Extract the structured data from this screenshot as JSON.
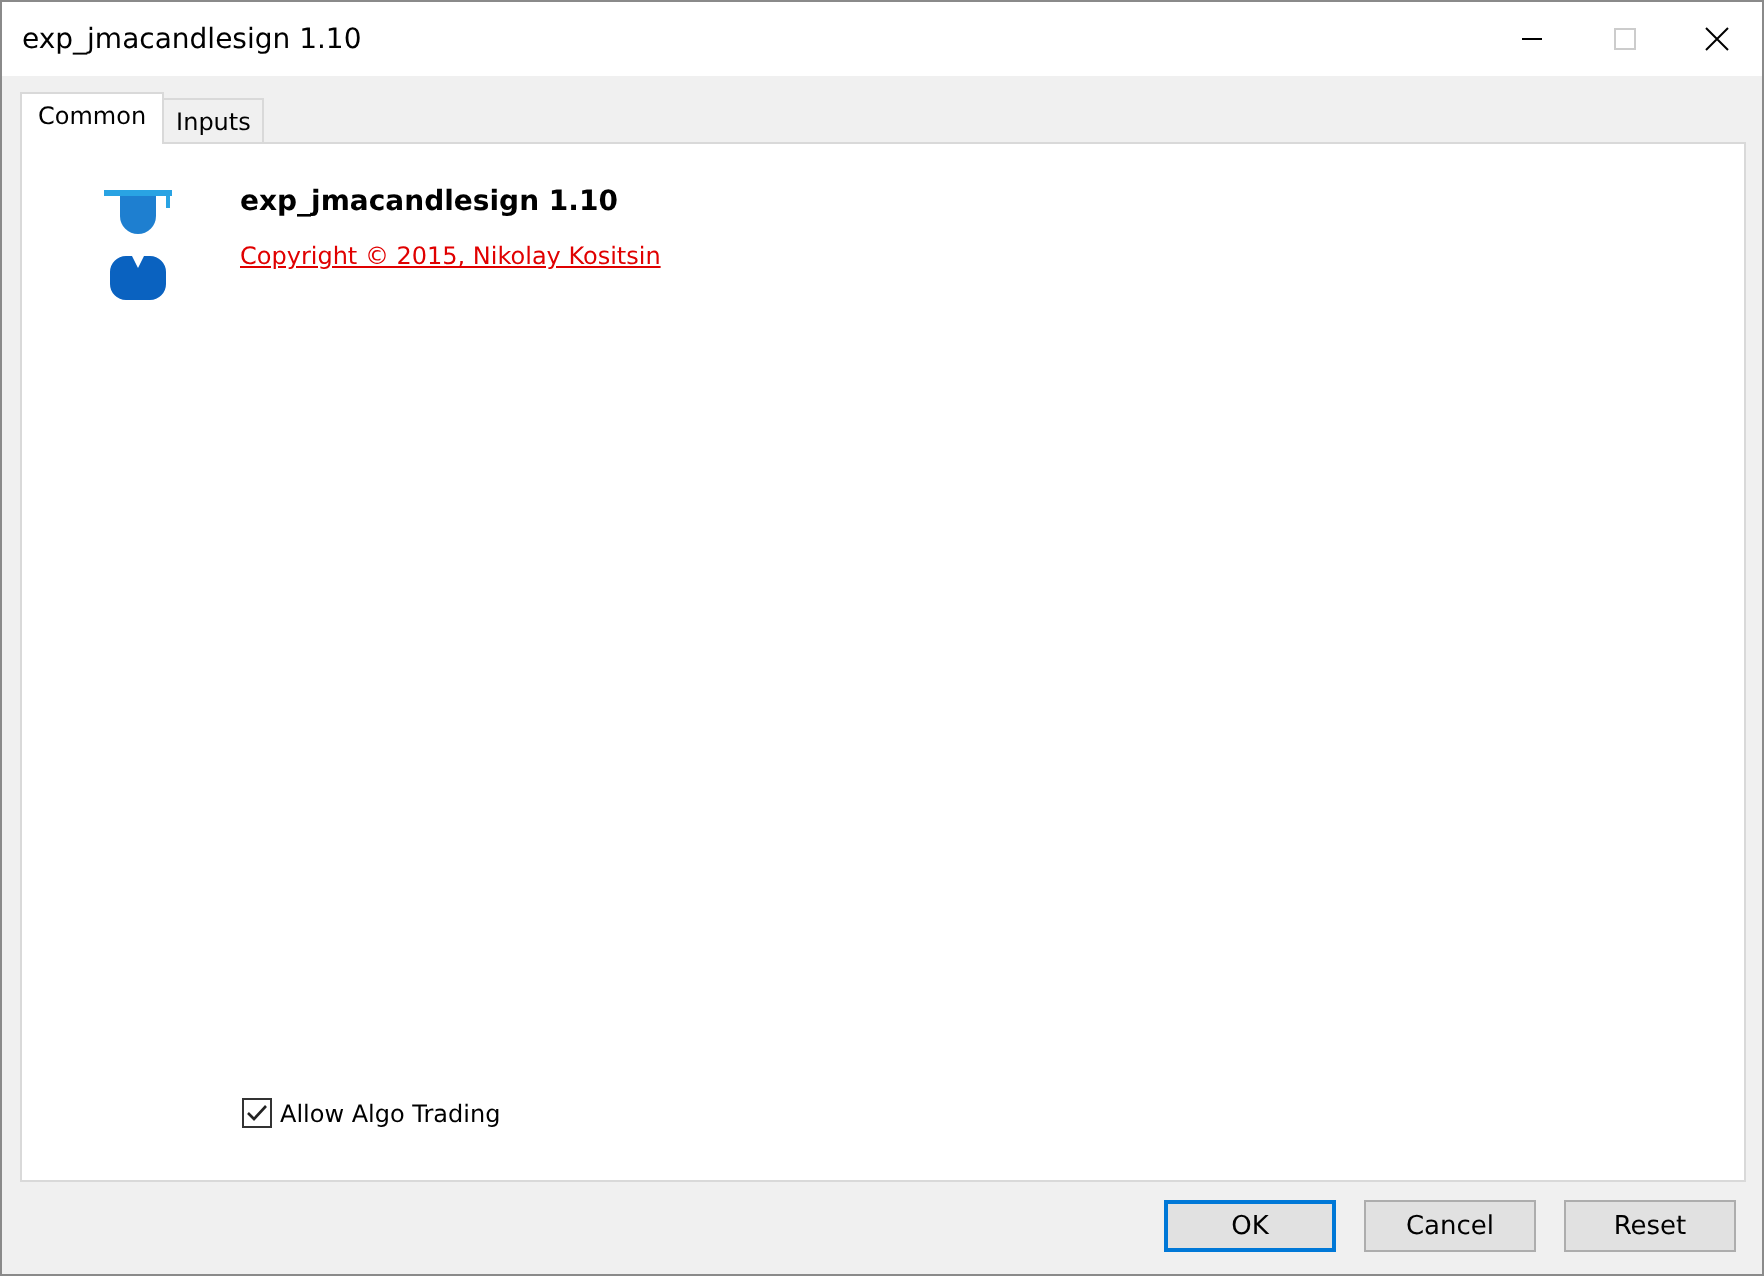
{
  "window": {
    "title": "exp_jmacandlesign 1.10"
  },
  "tabs": [
    {
      "label": "Common",
      "selected": true
    },
    {
      "label": "Inputs",
      "selected": false
    }
  ],
  "program": {
    "name": "exp_jmacandlesign 1.10",
    "copyright": "Copyright © 2015, Nikolay Kositsin"
  },
  "allow_algo_trading": {
    "label": "Allow Algo Trading",
    "checked": true
  },
  "buttons": [
    {
      "label": "OK",
      "default": true
    },
    {
      "label": "Cancel",
      "default": false
    },
    {
      "label": "Reset",
      "default": false
    }
  ]
}
